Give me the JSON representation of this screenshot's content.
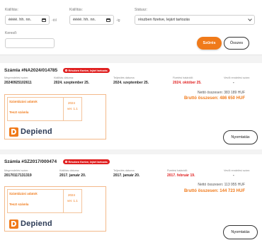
{
  "filters": {
    "issued_label": "Kiállítás:",
    "issued_from": "éééé. hh. nn.",
    "from_suffix": "-tól",
    "due_label": "Kiállítás:",
    "issued_to": "éééé. hh. nn.",
    "to_suffix": "-ig",
    "status_label": "Státusz:",
    "status_value": "részben fizetve, lejárt tartozás",
    "buyer_label": "Kereső:",
    "buyer_value": "",
    "filter_button": "Szűrés",
    "all_button": "Összes"
  },
  "invoices": [
    {
      "title": "Számla #NA2024/014785",
      "badge": "Részben fizetve, lejárt tartozás",
      "labels": [
        "Megrendelési szám:",
        "Kiállítás dátuma:",
        "Teljesítés dátuma:",
        "Fizetési határidő:",
        "Vevői rendelési szám:"
      ],
      "order_no": "20240925102611",
      "issue_date": "2024. szeptember 25.",
      "fulfil_date": "2024. szeptember 25.",
      "due_date": "2024. október 25.",
      "customer_order": "-",
      "net": "Nettó összesen: 383 189 HUF",
      "gross": "Bruttó összesen: 486 650 HUF",
      "preview": {
        "title": "Számlázási adatok",
        "sub": "Teszt számla",
        "year": "2024",
        "version": "ver. 1.1",
        "logo": "Depiend"
      },
      "print": "Nyomtatás"
    },
    {
      "title": "Számla #SZ2017/000474",
      "badge": "Részben fizetve, lejárt tartozás",
      "labels": [
        "Megrendelési szám:",
        "Kiállítás dátuma:",
        "Teljesítés dátuma:",
        "Fizetési határidő:",
        "Vevői rendelési szám:"
      ],
      "order_no": "20170117131319",
      "issue_date": "2017. január 20.",
      "fulfil_date": "2017. január 20.",
      "due_date": "2017. február 19.",
      "customer_order": "-",
      "net": "Nettó összesen: 113 955 HUF",
      "gross": "Bruttó összesen: 144 723 HUF",
      "preview": {
        "title": "Számlázási adatok",
        "sub": "Teszt számla",
        "year": "2024",
        "version": "ver. 1.1",
        "logo": "Depiend"
      },
      "print": "Nyomtatás"
    }
  ],
  "colors": {
    "accent": "#f07a1a",
    "danger": "#e02020",
    "logo_text": "#2b3a55"
  }
}
